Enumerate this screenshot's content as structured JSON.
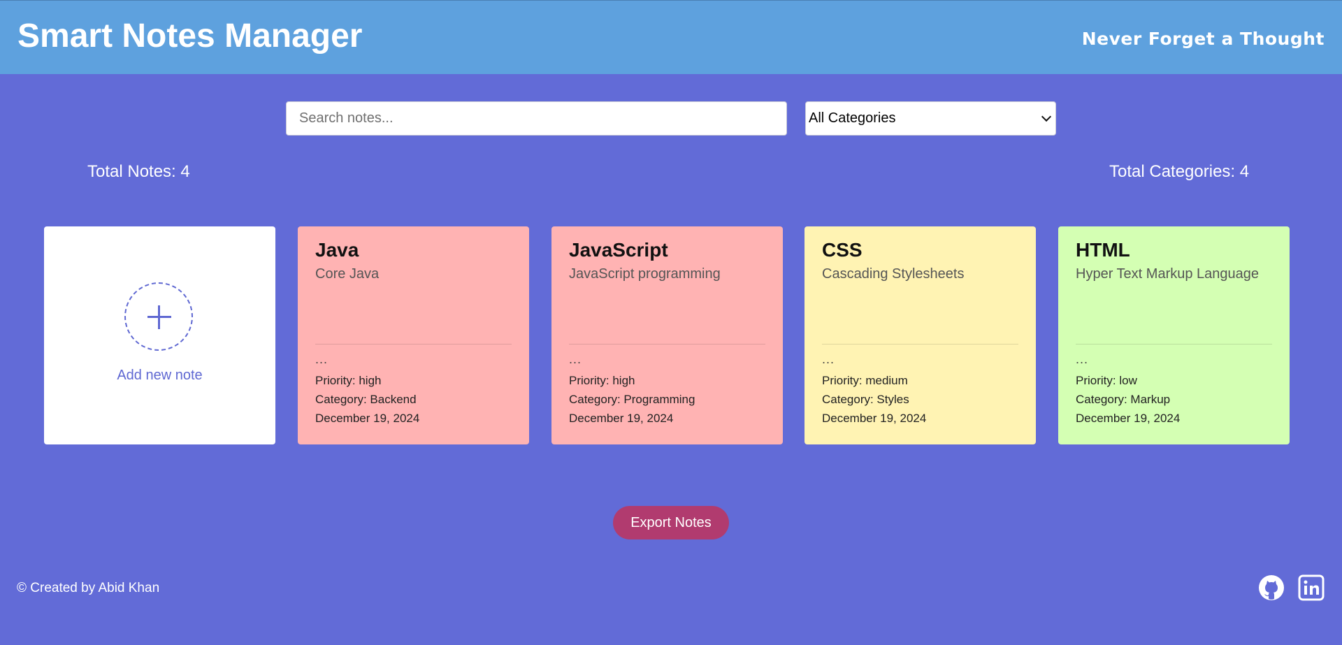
{
  "header": {
    "title": "Smart Notes Manager",
    "tagline": "Never Forget a Thought"
  },
  "search": {
    "placeholder": "Search notes...",
    "value": ""
  },
  "category_filter": {
    "selected": "All Categories"
  },
  "stats": {
    "total_notes": "Total Notes: 4",
    "total_categories": "Total Categories: 4"
  },
  "add_card": {
    "label": "Add new note"
  },
  "notes": [
    {
      "title": "Java",
      "subtitle": "Core Java",
      "ellipsis": "...",
      "priority": "Priority: high",
      "category": "Category: Backend",
      "date": "December 19, 2024",
      "color": "#ffb3b3"
    },
    {
      "title": "JavaScript",
      "subtitle": "JavaScript programming",
      "ellipsis": "...",
      "priority": "Priority: high",
      "category": "Category: Programming",
      "date": "December 19, 2024",
      "color": "#ffb3b3"
    },
    {
      "title": "CSS",
      "subtitle": "Cascading Stylesheets",
      "ellipsis": "...",
      "priority": "Priority: medium",
      "category": "Category: Styles",
      "date": "December 19, 2024",
      "color": "#fff3b3"
    },
    {
      "title": "HTML",
      "subtitle": "Hyper Text Markup Language",
      "ellipsis": "...",
      "priority": "Priority: low",
      "category": "Category: Markup",
      "date": "December 19, 2024",
      "color": "#d4ffb3"
    }
  ],
  "export": {
    "label": "Export Notes"
  },
  "footer": {
    "credit": "© Created by Abid Khan"
  },
  "icons": {
    "github": "github-icon",
    "linkedin": "linkedin-icon"
  },
  "colors": {
    "background": "#626bd7",
    "header": "#5ea1de",
    "accent": "#5f68d2",
    "export_button": "#b13b6f"
  }
}
